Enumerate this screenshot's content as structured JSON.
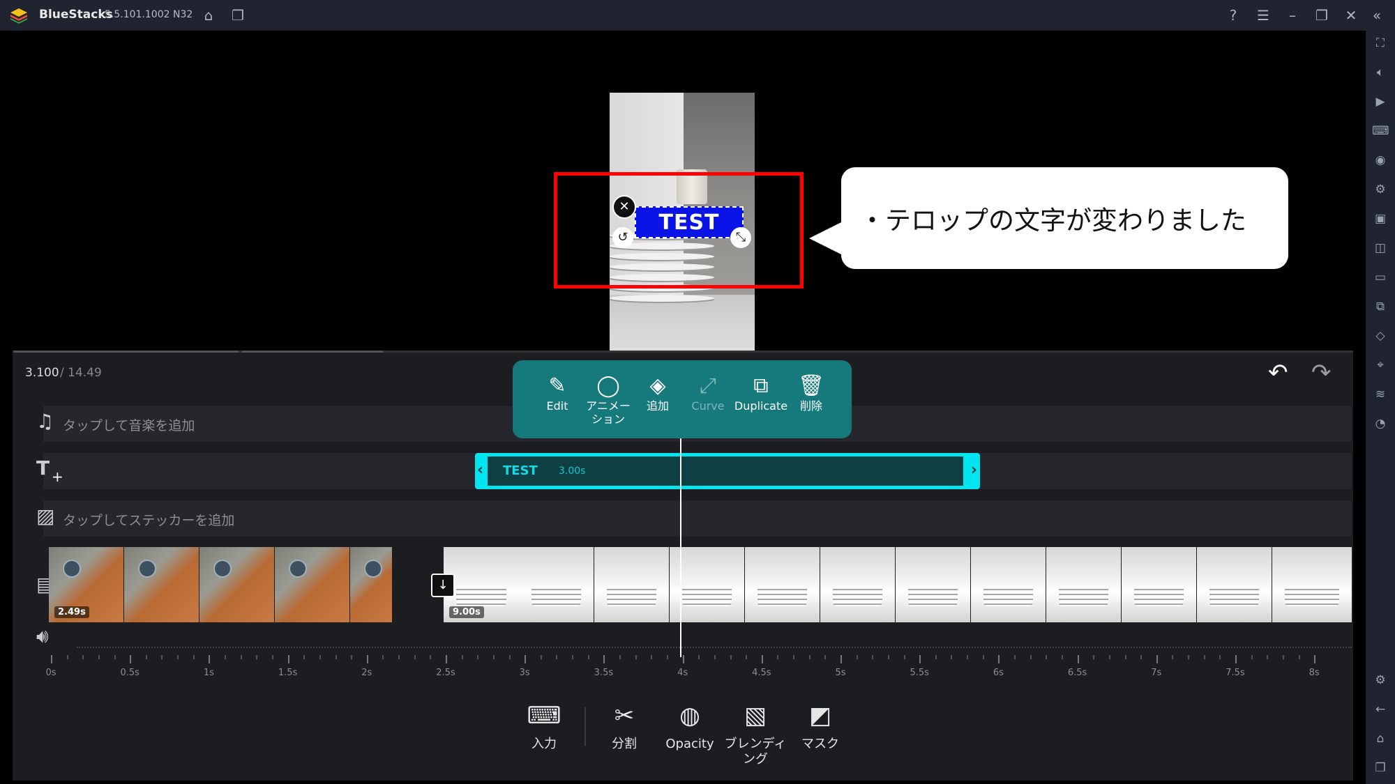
{
  "titlebar": {
    "app_name": "BlueStacks",
    "version": "5.5.101.1002 N32"
  },
  "preview": {
    "sticker_text": "TEST",
    "close_glyph": "✕",
    "rotate_glyph": "↺",
    "resize_glyph": "⤡"
  },
  "callout": {
    "text": "・テロップの文字が変わりました"
  },
  "timeline": {
    "current_time": "3.100",
    "total_time": "/ 14.49",
    "music_lane": "タップして音楽を追加",
    "sticker_lane": "タップしてステッカーを追加",
    "text_clip": {
      "name": "TEST",
      "duration": "3.00s"
    },
    "clip1_duration": "2.49s",
    "clip2_duration": "9.00s",
    "ruler_labels": [
      "0s",
      "0.5s",
      "1s",
      "1.5s",
      "2s",
      "2.5s",
      "3s",
      "3.5s",
      "4s",
      "4.5s",
      "5s",
      "5.5s",
      "6s",
      "6.5s",
      "7s",
      "7.5s",
      "8s"
    ]
  },
  "popup": {
    "edit": "Edit",
    "animation": "アニメーション",
    "add": "追加",
    "curve": "Curve",
    "duplicate": "Duplicate",
    "delete": "削除"
  },
  "bottom_tools": {
    "input": "入力",
    "split": "分割",
    "opacity": "Opacity",
    "blending": "ブレンディング",
    "mask": "マスク"
  },
  "colors": {
    "accent": "#00e5f0",
    "popup": "#167a7d",
    "sticker_bg": "#0a14e6",
    "highlight_box": "#ff0000"
  }
}
